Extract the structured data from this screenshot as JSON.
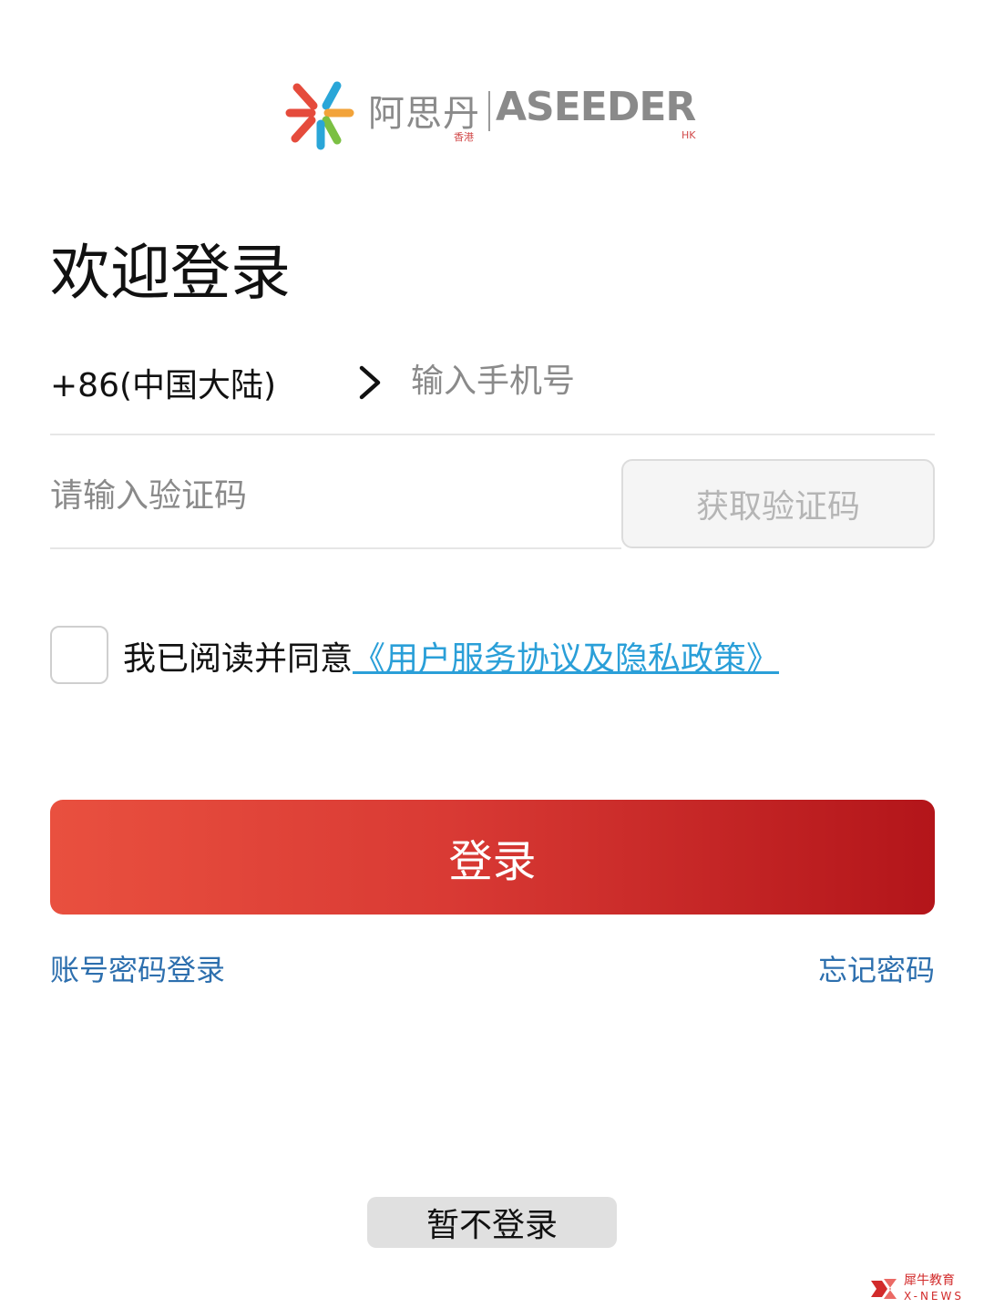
{
  "logo": {
    "brand_cn": "阿思丹",
    "brand_cn_sub": "香港",
    "brand_en": "ASEEDER",
    "brand_en_sub": "HK",
    "icon": "asterisk-logo-icon",
    "colors": [
      "#e54b3c",
      "#2aa6d8",
      "#f2a33a",
      "#7bc043"
    ]
  },
  "header": {
    "title": "欢迎登录"
  },
  "phone": {
    "country_code": "+86(中国大陆)",
    "chevron_icon": "chevron-right-icon",
    "placeholder": "输入手机号"
  },
  "verification": {
    "placeholder": "请输入验证码",
    "get_code_label": "获取验证码"
  },
  "agreement": {
    "text": "我已阅读并同意",
    "link_text": "《用户服务协议及隐私政策》",
    "link_color": "#2a9fd8"
  },
  "login": {
    "label": "登录",
    "gradient_start": "#e9503f",
    "gradient_end": "#b3151a"
  },
  "links": {
    "account_password_login": "账号密码登录",
    "forgot_password": "忘记密码"
  },
  "skip": {
    "label": "暂不登录"
  },
  "watermark": {
    "text": "犀牛教育",
    "sub": "X-NEWS"
  }
}
